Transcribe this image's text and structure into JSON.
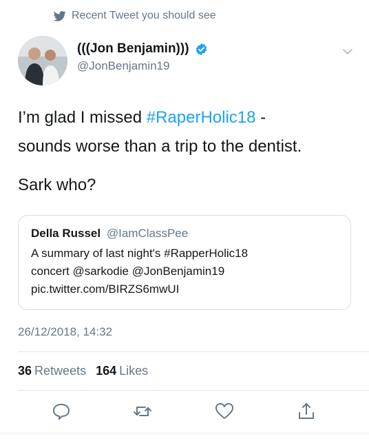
{
  "context": {
    "label": "Recent Tweet you should see",
    "icon": "bird-icon"
  },
  "author": {
    "name": "(((Jon Benjamin)))",
    "handle": "@JonBenjamin19",
    "verified": true
  },
  "tweet": {
    "line1_prefix": "I’m glad I missed ",
    "line1_hashtag": "#RaperHolic18",
    "line1_suffix": " -",
    "line2": "sounds worse than a trip to the dentist.",
    "line3": "Sark who?"
  },
  "quoted_tweet": {
    "name": "Della Russel",
    "handle": "@IamClassPee",
    "line1": "A summary of last night's #RapperHolic18",
    "line2": "concert @sarkodie @JonBenjamin19",
    "line3": "pic.twitter.com/BIRZS6mwUI"
  },
  "timestamp": "26/12/2018, 14:32",
  "stats": {
    "retweets_count": "36",
    "retweets_label": "Retweets",
    "likes_count": "164",
    "likes_label": "Likes"
  },
  "colors": {
    "accent": "#1da1f2",
    "secondary_text": "#657786",
    "divider": "#e1e8ed"
  },
  "actions": [
    "reply-icon",
    "retweet-icon",
    "like-icon",
    "share-icon"
  ]
}
